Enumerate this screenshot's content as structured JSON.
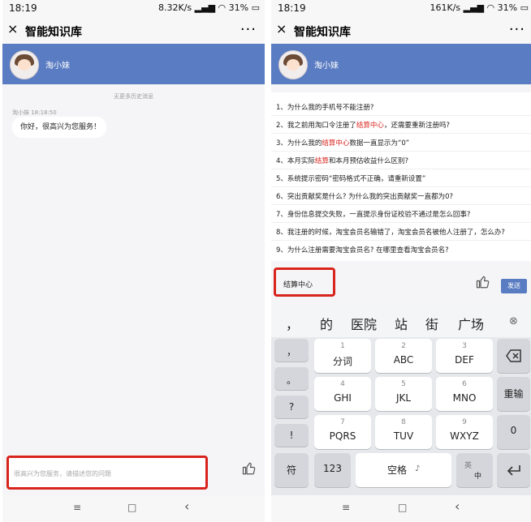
{
  "status": {
    "time": "18:19",
    "left_speed": "8.32K/s",
    "right_speed": "161K/s",
    "battery": "31%"
  },
  "header": {
    "title": "智能知识库",
    "more": "···"
  },
  "agent": {
    "name": "淘小妹"
  },
  "chat": {
    "history_notice": "无更多历史消息",
    "message_meta": "淘小妹   18:18:50",
    "message": "你好，很高兴为您服务！"
  },
  "input": {
    "placeholder": "很高兴为您服务，请描述您的问题",
    "value": "结算中心"
  },
  "faq": [
    {
      "pre": "1、为什么我的手机号不能注册?",
      "red": "",
      "post": ""
    },
    {
      "pre": "2、我之前用淘口令注册了",
      "red": "结算中心",
      "post": "，还需要重新注册吗?"
    },
    {
      "pre": "3、为什么我的",
      "red": "结算中心",
      "post": "数据一直显示为“0”"
    },
    {
      "pre": "4、本月实际",
      "red": "结算",
      "post": "和本月预估收益什么区别?"
    },
    {
      "pre": "5、系统提示密码“密码格式不正确，请重新设置”",
      "red": "",
      "post": ""
    },
    {
      "pre": "6、突出贡献奖是什么? 为什么我的突出贡献奖一直都为0?",
      "red": "",
      "post": ""
    },
    {
      "pre": "7、身份信息提交失败，一直提示身份证校验不通过是怎么回事?",
      "red": "",
      "post": ""
    },
    {
      "pre": "8、我注册的时候，淘宝会员名输错了，淘宝会员名被他人注册了，怎么办?",
      "red": "",
      "post": ""
    },
    {
      "pre": "9、为什么注册需要淘宝会员名? 在哪里查看淘宝会员名?",
      "red": "",
      "post": ""
    }
  ],
  "send_label": "发送",
  "keyboard": {
    "candidates": [
      "，",
      "的",
      "医院",
      "站",
      "街",
      "广场"
    ],
    "side": [
      "，",
      "。",
      "?",
      "!"
    ],
    "keys": [
      {
        "n": "1",
        "l": "分词"
      },
      {
        "n": "2",
        "l": "ABC"
      },
      {
        "n": "3",
        "l": "DEF"
      },
      {
        "n": "4",
        "l": "GHI"
      },
      {
        "n": "5",
        "l": "JKL"
      },
      {
        "n": "6",
        "l": "MNO"
      },
      {
        "n": "7",
        "l": "PQRS"
      },
      {
        "n": "8",
        "l": "TUV"
      },
      {
        "n": "9",
        "l": "WXYZ"
      }
    ],
    "reenter": "重输",
    "zero": "0",
    "symbol": "符",
    "num": "123",
    "space": "空格",
    "lang_top": "英",
    "lang_bottom": "中"
  },
  "icons": {
    "close": "×",
    "thumb": "thumbs-up-icon",
    "delete": "backspace-icon",
    "enter": "enter-icon",
    "mic": "mic-icon",
    "clear_candidates": "clear-icon",
    "nav_menu": "≡",
    "nav_home": "□",
    "nav_back": "‹"
  }
}
